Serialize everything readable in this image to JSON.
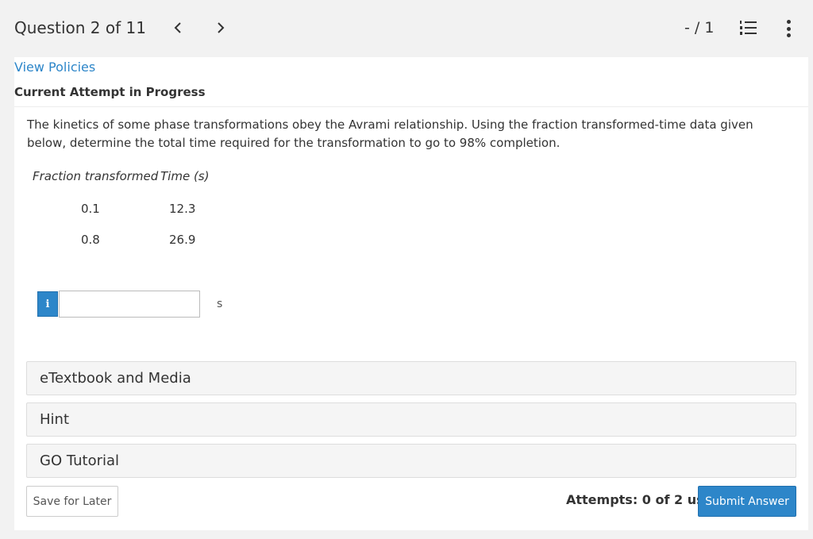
{
  "header": {
    "question_label": "Question 2 of 11",
    "score": "- / 1"
  },
  "links": {
    "view_policies": "View Policies"
  },
  "status": {
    "attempt_label": "Current Attempt in Progress"
  },
  "question": {
    "text": "The kinetics of some phase transformations obey the Avrami relationship. Using the fraction transformed-time data given below, determine the total time required for the transformation to go to 98% completion.",
    "table": {
      "headers": [
        "Fraction transformed",
        "Time (s)"
      ],
      "rows": [
        [
          "0.1",
          "12.3"
        ],
        [
          "0.8",
          "26.9"
        ]
      ]
    }
  },
  "answer": {
    "info_glyph": "i",
    "value": "",
    "unit": "s"
  },
  "resources": [
    "eTextbook and Media",
    "Hint",
    "GO Tutorial"
  ],
  "footer": {
    "save_label": "Save for Later",
    "attempts_text": "Attempts: 0 of 2 used",
    "submit_label": "Submit Answer"
  },
  "colors": {
    "accent": "#2d86c9",
    "page_bg": "#f2f2f2"
  }
}
